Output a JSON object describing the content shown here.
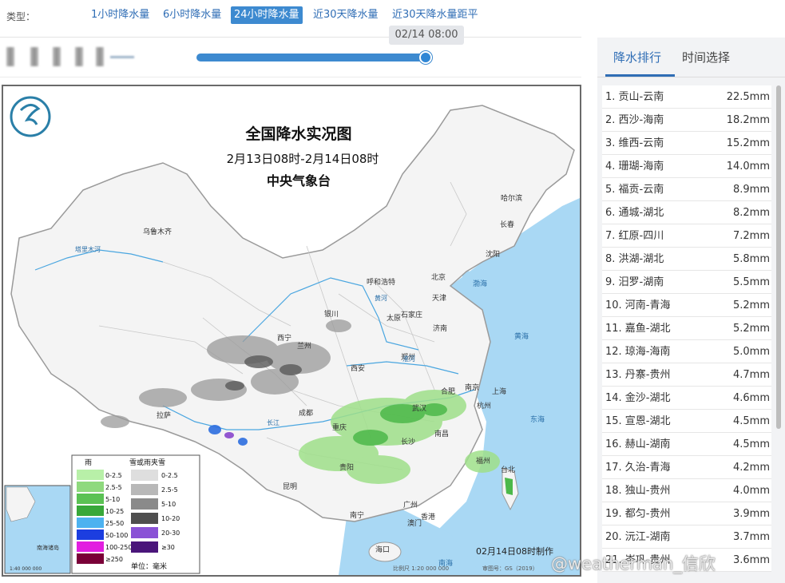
{
  "typebar": {
    "label": "类型：",
    "tabs": [
      "1小时降水量",
      "6小时降水量",
      "24小时降水量",
      "近30天降水量",
      "近30天降水量距平"
    ],
    "active_index": 2
  },
  "timeline": {
    "tooltip": "02/14 08:00",
    "progress": 1.0
  },
  "map": {
    "title": "全国降水实况图",
    "subtitle": "2月13日08时-2月14日08时",
    "agency": "中央气象台",
    "cities": [
      "乌鲁木齐",
      "哈尔滨",
      "长春",
      "沈阳",
      "呼和浩特",
      "北京",
      "天津",
      "银川",
      "石家庄",
      "太原",
      "济南",
      "西宁",
      "兰州",
      "郑州",
      "西安",
      "南京",
      "上海",
      "合肥",
      "成都",
      "武汉",
      "杭州",
      "拉萨",
      "重庆",
      "南昌",
      "长沙",
      "福州",
      "贵阳",
      "昆明",
      "台北",
      "南宁",
      "广州",
      "香港",
      "澳门",
      "海口"
    ],
    "seas": [
      "渤海",
      "黄海",
      "东海",
      "南海"
    ],
    "rivers": [
      "黄河",
      "长江",
      "塔里木河",
      "淮河"
    ],
    "legend": {
      "rain_title": "雨",
      "snow_title": "雪或雨夹雪",
      "rain_bins": [
        "0-2.5",
        "2.5-5",
        "5-10",
        "10-25",
        "25-50",
        "50-100",
        "100-250",
        "≥250"
      ],
      "rain_colors": [
        "#b8f0a8",
        "#8fd97e",
        "#5bc254",
        "#38a83a",
        "#4db2f0",
        "#1c3ee0",
        "#e21fe0",
        "#7a0038"
      ],
      "snow_bins": [
        "0-2.5",
        "2.5-5",
        "5-10",
        "10-20",
        "20-30",
        "≥30"
      ],
      "snow_colors": [
        "#dedede",
        "#b8b8b8",
        "#8a8a8a",
        "#4e4e4e",
        "#8a52d6",
        "#4a157a"
      ],
      "unit": "单位：毫米"
    },
    "inset_label": "南海诸岛",
    "inset_scale": "1:40 000 000",
    "footer_made": "02月14日08时制作",
    "footer_scale": "比例尺 1:20 000 000",
    "footer_review": "审图号：GS（2019）"
  },
  "side": {
    "tabs": [
      "降水排行",
      "时间选择"
    ],
    "active_index": 0,
    "ranking": [
      {
        "name": "1. 贡山-云南",
        "value": "22.5mm"
      },
      {
        "name": "2. 西沙-海南",
        "value": "18.2mm"
      },
      {
        "name": "3. 维西-云南",
        "value": "15.2mm"
      },
      {
        "name": "4. 珊瑚-海南",
        "value": "14.0mm"
      },
      {
        "name": "5. 福贡-云南",
        "value": "8.9mm"
      },
      {
        "name": "6. 通城-湖北",
        "value": "8.2mm"
      },
      {
        "name": "7. 红原-四川",
        "value": "7.2mm"
      },
      {
        "name": "8. 洪湖-湖北",
        "value": "5.8mm"
      },
      {
        "name": "9. 汨罗-湖南",
        "value": "5.5mm"
      },
      {
        "name": "10. 河南-青海",
        "value": "5.2mm"
      },
      {
        "name": "11. 嘉鱼-湖北",
        "value": "5.2mm"
      },
      {
        "name": "12. 琼海-海南",
        "value": "5.0mm"
      },
      {
        "name": "13. 丹寨-贵州",
        "value": "4.7mm"
      },
      {
        "name": "14. 金沙-湖北",
        "value": "4.6mm"
      },
      {
        "name": "15. 宣恩-湖北",
        "value": "4.5mm"
      },
      {
        "name": "16. 赫山-湖南",
        "value": "4.5mm"
      },
      {
        "name": "17. 久治-青海",
        "value": "4.2mm"
      },
      {
        "name": "18. 独山-贵州",
        "value": "4.0mm"
      },
      {
        "name": "19. 都匀-贵州",
        "value": "3.9mm"
      },
      {
        "name": "20. 沅江-湖南",
        "value": "3.7mm"
      },
      {
        "name": "21. 岑巩-贵州",
        "value": "3.6mm"
      }
    ]
  },
  "watermark": "@weatherman_信欣",
  "colors": {
    "accent": "#2f6db5",
    "active_tab_bg": "#3d8ad0",
    "slider": "#3d8ad0"
  }
}
